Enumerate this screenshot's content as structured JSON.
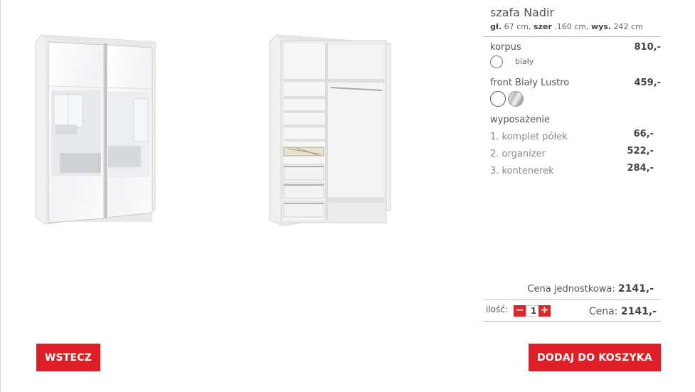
{
  "product": {
    "name": "szafa Nadir",
    "dims": {
      "depth_label": "gł.",
      "depth_value": "67 cm,",
      "width_label": "szer",
      "width_value": ".160 cm,",
      "height_label": "wys.",
      "height_value": "242 cm"
    }
  },
  "korpus": {
    "label": "korpus",
    "price": "810,-",
    "swatch_name": "biały"
  },
  "front": {
    "label": "front Biały Lustro",
    "price": "459,-"
  },
  "equipment": {
    "heading": "wyposażenie",
    "items": [
      {
        "name": "1. komplet półek",
        "price": "66,-"
      },
      {
        "name": "2. organizer",
        "price": "522,-"
      },
      {
        "name": "3. kontenerek",
        "price": "284,-"
      }
    ]
  },
  "summary": {
    "unit_label": "Cena jednostkowa:",
    "unit_price": "2141,-",
    "qty_label": "ilość:",
    "qty_minus": "−",
    "qty_value": "1",
    "qty_plus": "+",
    "total_label": "Cena:",
    "total_price": "2141,-"
  },
  "actions": {
    "back": "WSTECZ",
    "add_to_cart": "DODAJ DO KOSZYKA"
  },
  "colors": {
    "accent": "#de1f27",
    "text": "#444444"
  }
}
